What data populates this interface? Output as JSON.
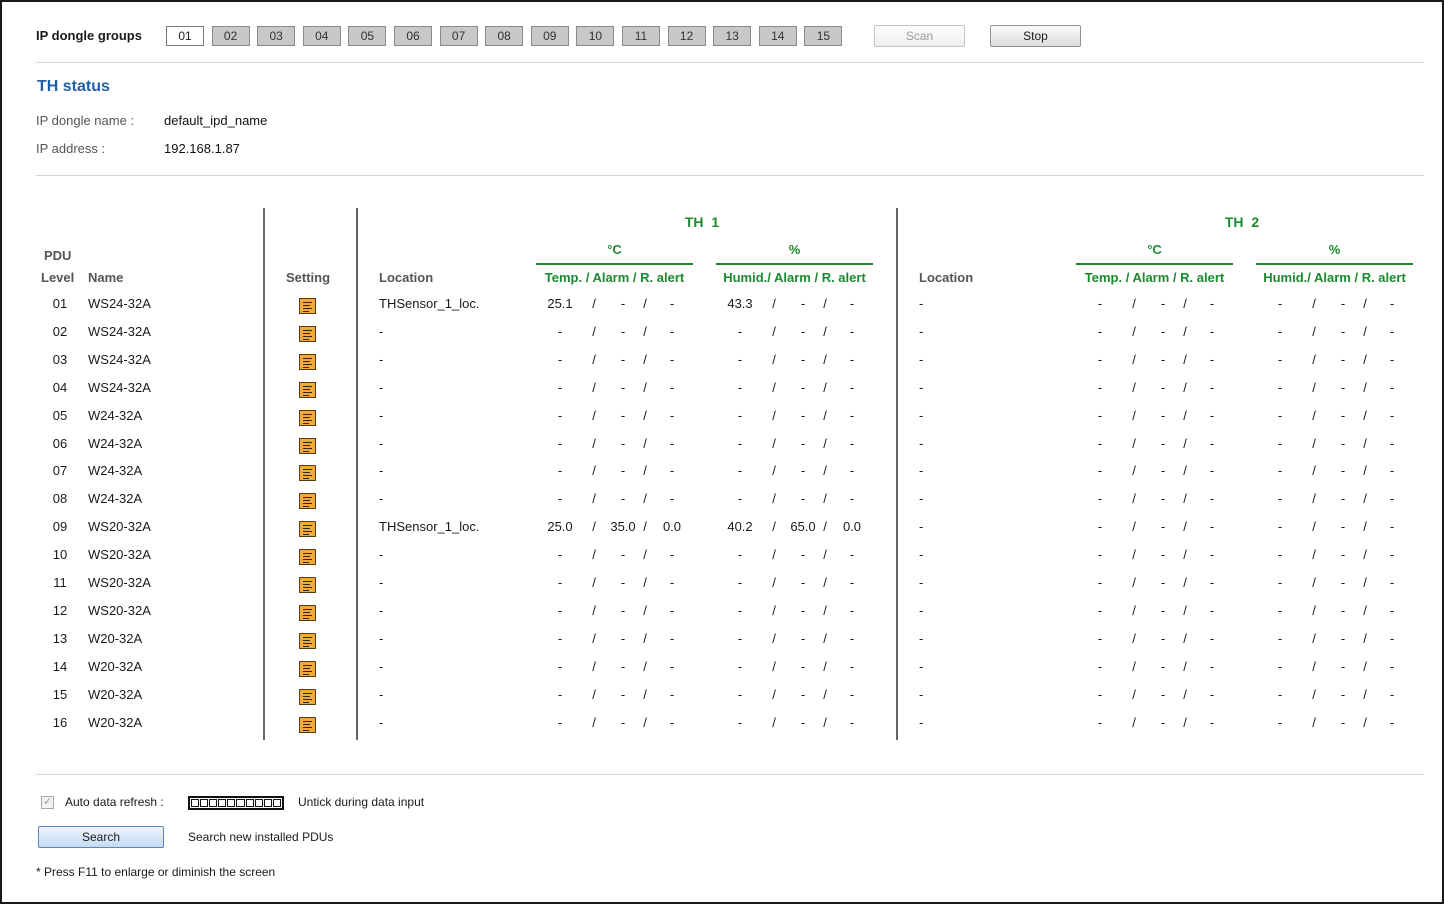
{
  "header": {
    "groups_label": "IP dongle groups",
    "groups": [
      "01",
      "02",
      "03",
      "04",
      "05",
      "06",
      "07",
      "08",
      "09",
      "10",
      "11",
      "12",
      "13",
      "14",
      "15"
    ],
    "active_group": "01",
    "scan_label": "Scan",
    "stop_label": "Stop"
  },
  "status": {
    "title": "TH status",
    "dongle_name_label": "IP dongle name :",
    "dongle_name": "default_ipd_name",
    "ip_label": "IP address :",
    "ip": "192.168.1.87"
  },
  "table": {
    "pdu_label": "PDU",
    "level_label": "Level",
    "name_label": "Name",
    "setting_label": "Setting",
    "location_label": "Location",
    "th1_label": "TH  1",
    "th2_label": "TH  2",
    "celsius_label": "°C",
    "percent_label": "%",
    "temp_header": "Temp. / Alarm / R. alert",
    "humid_header": "Humid./ Alarm / R. alert",
    "rows": [
      {
        "level": "01",
        "name": "WS24-32A",
        "loc1": "THSensor_1_loc.",
        "t1": [
          "25.1",
          "-",
          "-"
        ],
        "h1": [
          "43.3",
          "-",
          "-"
        ],
        "loc2": "-",
        "t2": [
          "-",
          "-",
          "-"
        ],
        "h2": [
          "-",
          "-",
          "-"
        ]
      },
      {
        "level": "02",
        "name": "WS24-32A",
        "loc1": "-",
        "t1": [
          "-",
          "-",
          "-"
        ],
        "h1": [
          "-",
          "-",
          "-"
        ],
        "loc2": "-",
        "t2": [
          "-",
          "-",
          "-"
        ],
        "h2": [
          "-",
          "-",
          "-"
        ]
      },
      {
        "level": "03",
        "name": "WS24-32A",
        "loc1": "-",
        "t1": [
          "-",
          "-",
          "-"
        ],
        "h1": [
          "-",
          "-",
          "-"
        ],
        "loc2": "-",
        "t2": [
          "-",
          "-",
          "-"
        ],
        "h2": [
          "-",
          "-",
          "-"
        ]
      },
      {
        "level": "04",
        "name": "WS24-32A",
        "loc1": "-",
        "t1": [
          "-",
          "-",
          "-"
        ],
        "h1": [
          "-",
          "-",
          "-"
        ],
        "loc2": "-",
        "t2": [
          "-",
          "-",
          "-"
        ],
        "h2": [
          "-",
          "-",
          "-"
        ]
      },
      {
        "level": "05",
        "name": "W24-32A",
        "loc1": "-",
        "t1": [
          "-",
          "-",
          "-"
        ],
        "h1": [
          "-",
          "-",
          "-"
        ],
        "loc2": "-",
        "t2": [
          "-",
          "-",
          "-"
        ],
        "h2": [
          "-",
          "-",
          "-"
        ]
      },
      {
        "level": "06",
        "name": "W24-32A",
        "loc1": "-",
        "t1": [
          "-",
          "-",
          "-"
        ],
        "h1": [
          "-",
          "-",
          "-"
        ],
        "loc2": "-",
        "t2": [
          "-",
          "-",
          "-"
        ],
        "h2": [
          "-",
          "-",
          "-"
        ]
      },
      {
        "level": "07",
        "name": "W24-32A",
        "loc1": "-",
        "t1": [
          "-",
          "-",
          "-"
        ],
        "h1": [
          "-",
          "-",
          "-"
        ],
        "loc2": "-",
        "t2": [
          "-",
          "-",
          "-"
        ],
        "h2": [
          "-",
          "-",
          "-"
        ]
      },
      {
        "level": "08",
        "name": "W24-32A",
        "loc1": "-",
        "t1": [
          "-",
          "-",
          "-"
        ],
        "h1": [
          "-",
          "-",
          "-"
        ],
        "loc2": "-",
        "t2": [
          "-",
          "-",
          "-"
        ],
        "h2": [
          "-",
          "-",
          "-"
        ]
      },
      {
        "level": "09",
        "name": "WS20-32A",
        "loc1": "THSensor_1_loc.",
        "t1": [
          "25.0",
          "35.0",
          "0.0"
        ],
        "h1": [
          "40.2",
          "65.0",
          "0.0"
        ],
        "loc2": "-",
        "t2": [
          "-",
          "-",
          "-"
        ],
        "h2": [
          "-",
          "-",
          "-"
        ]
      },
      {
        "level": "10",
        "name": "WS20-32A",
        "loc1": "-",
        "t1": [
          "-",
          "-",
          "-"
        ],
        "h1": [
          "-",
          "-",
          "-"
        ],
        "loc2": "-",
        "t2": [
          "-",
          "-",
          "-"
        ],
        "h2": [
          "-",
          "-",
          "-"
        ]
      },
      {
        "level": "11",
        "name": "WS20-32A",
        "loc1": "-",
        "t1": [
          "-",
          "-",
          "-"
        ],
        "h1": [
          "-",
          "-",
          "-"
        ],
        "loc2": "-",
        "t2": [
          "-",
          "-",
          "-"
        ],
        "h2": [
          "-",
          "-",
          "-"
        ]
      },
      {
        "level": "12",
        "name": "WS20-32A",
        "loc1": "-",
        "t1": [
          "-",
          "-",
          "-"
        ],
        "h1": [
          "-",
          "-",
          "-"
        ],
        "loc2": "-",
        "t2": [
          "-",
          "-",
          "-"
        ],
        "h2": [
          "-",
          "-",
          "-"
        ]
      },
      {
        "level": "13",
        "name": "W20-32A",
        "loc1": "-",
        "t1": [
          "-",
          "-",
          "-"
        ],
        "h1": [
          "-",
          "-",
          "-"
        ],
        "loc2": "-",
        "t2": [
          "-",
          "-",
          "-"
        ],
        "h2": [
          "-",
          "-",
          "-"
        ]
      },
      {
        "level": "14",
        "name": "W20-32A",
        "loc1": "-",
        "t1": [
          "-",
          "-",
          "-"
        ],
        "h1": [
          "-",
          "-",
          "-"
        ],
        "loc2": "-",
        "t2": [
          "-",
          "-",
          "-"
        ],
        "h2": [
          "-",
          "-",
          "-"
        ]
      },
      {
        "level": "15",
        "name": "W20-32A",
        "loc1": "-",
        "t1": [
          "-",
          "-",
          "-"
        ],
        "h1": [
          "-",
          "-",
          "-"
        ],
        "loc2": "-",
        "t2": [
          "-",
          "-",
          "-"
        ],
        "h2": [
          "-",
          "-",
          "-"
        ]
      },
      {
        "level": "16",
        "name": "W20-32A",
        "loc1": "-",
        "t1": [
          "-",
          "-",
          "-"
        ],
        "h1": [
          "-",
          "-",
          "-"
        ],
        "loc2": "-",
        "t2": [
          "-",
          "-",
          "-"
        ],
        "h2": [
          "-",
          "-",
          "-"
        ]
      }
    ]
  },
  "footer": {
    "auto_refresh_label": "Auto data refresh :",
    "auto_refresh_checked": true,
    "untick_note": "Untick during data input",
    "search_label": "Search",
    "search_note": "Search new installed PDUs",
    "f11_note": "* Press F11 to enlarge or diminish the screen"
  },
  "colors": {
    "accent_blue": "#1f5fa8",
    "th_green": "#1b8a2e",
    "setting_icon": "#f2a93b"
  },
  "icons": {
    "setting": "document-lines-icon",
    "checkbox": "checkmark-icon"
  }
}
